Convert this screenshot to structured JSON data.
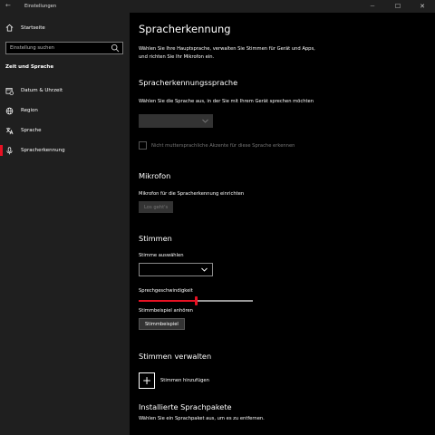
{
  "window": {
    "title": "Einstellungen",
    "back_glyph": "←",
    "minimize_glyph": "—",
    "maximize_glyph": "☐",
    "close_glyph": "✕"
  },
  "sidebar": {
    "home_label": "Startseite",
    "search_placeholder": "Einstellung suchen",
    "section_title": "Zeit und Sprache",
    "items": [
      {
        "label": "Datum & Uhrzeit",
        "icon": "calendar-clock-icon"
      },
      {
        "label": "Region",
        "icon": "globe-icon"
      },
      {
        "label": "Sprache",
        "icon": "language-icon"
      },
      {
        "label": "Spracherkennung",
        "icon": "microphone-icon",
        "active": true
      }
    ],
    "accent_color": "#e81123"
  },
  "main": {
    "title": "Spracherkennung",
    "intro": "Wählen Sie Ihre Hauptsprache, verwalten Sie Stimmen für Gerät und Apps, und richten Sie Ihr Mikrofon ein.",
    "language_section": {
      "heading": "Spracherkennungssprache",
      "description": "Wählen Sie die Sprache aus, in der Sie mit Ihrem Gerät sprechen möchten",
      "dropdown_value": "",
      "checkbox_label": "Nicht muttersprachliche Akzente für diese Sprache erkennen",
      "checkbox_checked": false
    },
    "microphone_section": {
      "heading": "Mikrofon",
      "description": "Mikrofon für die Spracherkennung einrichten",
      "button_label": "Los geht's"
    },
    "voices_section": {
      "heading": "Stimmen",
      "voice_label": "Stimme auswählen",
      "voice_value": "",
      "speed_label": "Sprechgeschwindigkeit",
      "speed_value": 0.5,
      "sample_label": "Stimmbeispiel anhören",
      "sample_button": "Stimmbeispiel"
    },
    "manage_section": {
      "heading": "Stimmen verwalten",
      "add_label": "Stimmen hinzufügen",
      "add_glyph": "+"
    },
    "packages_section": {
      "heading": "Installierte Sprachpakete",
      "description": "Wählen Sie ein Sprachpaket aus, um es zu entfernen."
    }
  }
}
